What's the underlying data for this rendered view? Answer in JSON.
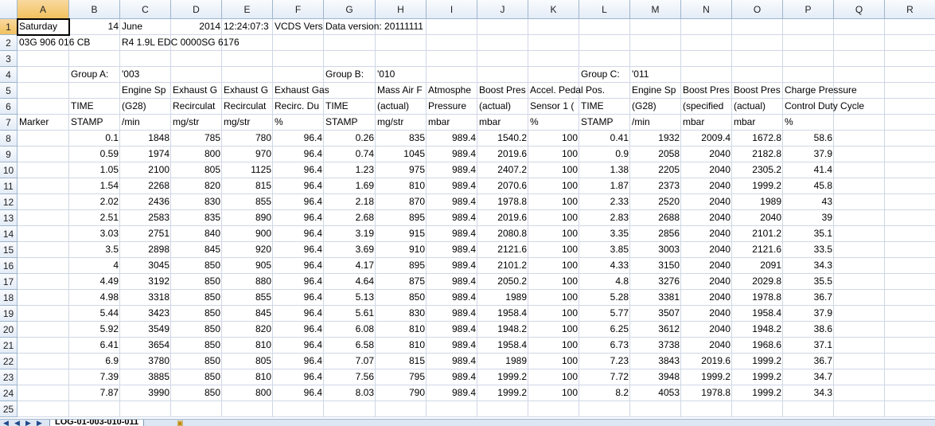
{
  "columns": [
    "A",
    "B",
    "C",
    "D",
    "E",
    "F",
    "G",
    "H",
    "I",
    "J",
    "K",
    "L",
    "M",
    "N",
    "O",
    "P",
    "Q",
    "R"
  ],
  "row_numbers": [
    "1",
    "2",
    "3",
    "4",
    "5",
    "6",
    "7",
    "8",
    "9",
    "10",
    "11",
    "12",
    "13",
    "14",
    "15",
    "16",
    "17",
    "18",
    "19",
    "20",
    "21",
    "22",
    "23",
    "24",
    "25"
  ],
  "active_cell": "A1",
  "sheet_tab": "LOG-01-003-010-011",
  "cells": [
    {
      "r": 0,
      "c": 0,
      "v": "Saturday"
    },
    {
      "r": 0,
      "c": 1,
      "v": "14",
      "n": true
    },
    {
      "r": 0,
      "c": 2,
      "v": "June"
    },
    {
      "r": 0,
      "c": 3,
      "v": "2014",
      "n": true
    },
    {
      "r": 0,
      "c": 4,
      "v": "12:24:07:3"
    },
    {
      "r": 0,
      "c": 5,
      "v": "VCDS Vers"
    },
    {
      "r": 0,
      "c": 6,
      "v": "Data version: 20111111",
      "o": true
    },
    {
      "r": 1,
      "c": 0,
      "v": "03G 906 016 CB",
      "o": true
    },
    {
      "r": 1,
      "c": 2,
      "v": "R4 1.9L EDC 0000SG  6176",
      "o": true
    },
    {
      "r": 3,
      "c": 1,
      "v": "Group A:"
    },
    {
      "r": 3,
      "c": 2,
      "v": "'003"
    },
    {
      "r": 3,
      "c": 6,
      "v": "Group B:"
    },
    {
      "r": 3,
      "c": 7,
      "v": "'010"
    },
    {
      "r": 3,
      "c": 11,
      "v": "Group C:"
    },
    {
      "r": 3,
      "c": 12,
      "v": "'011"
    },
    {
      "r": 4,
      "c": 2,
      "v": "Engine Sp"
    },
    {
      "r": 4,
      "c": 3,
      "v": "Exhaust G"
    },
    {
      "r": 4,
      "c": 4,
      "v": "Exhaust G"
    },
    {
      "r": 4,
      "c": 5,
      "v": "Exhaust Gas",
      "o": true
    },
    {
      "r": 4,
      "c": 7,
      "v": "Mass Air F"
    },
    {
      "r": 4,
      "c": 8,
      "v": "Atmosphe"
    },
    {
      "r": 4,
      "c": 9,
      "v": "Boost Pres"
    },
    {
      "r": 4,
      "c": 10,
      "v": "Accel. Pedal Pos.",
      "o": true
    },
    {
      "r": 4,
      "c": 12,
      "v": "Engine Sp"
    },
    {
      "r": 4,
      "c": 13,
      "v": "Boost Pres"
    },
    {
      "r": 4,
      "c": 14,
      "v": "Boost Pres"
    },
    {
      "r": 4,
      "c": 15,
      "v": "Charge Pressure",
      "o": true
    },
    {
      "r": 5,
      "c": 1,
      "v": "TIME"
    },
    {
      "r": 5,
      "c": 2,
      "v": "(G28)"
    },
    {
      "r": 5,
      "c": 3,
      "v": "Recirculat"
    },
    {
      "r": 5,
      "c": 4,
      "v": "Recirculat"
    },
    {
      "r": 5,
      "c": 5,
      "v": "Recirc. Du"
    },
    {
      "r": 5,
      "c": 6,
      "v": "TIME"
    },
    {
      "r": 5,
      "c": 7,
      "v": "(actual)"
    },
    {
      "r": 5,
      "c": 8,
      "v": "Pressure"
    },
    {
      "r": 5,
      "c": 9,
      "v": "(actual)"
    },
    {
      "r": 5,
      "c": 10,
      "v": "Sensor 1 ("
    },
    {
      "r": 5,
      "c": 11,
      "v": "TIME"
    },
    {
      "r": 5,
      "c": 12,
      "v": "(G28)"
    },
    {
      "r": 5,
      "c": 13,
      "v": "(specified"
    },
    {
      "r": 5,
      "c": 14,
      "v": "(actual)"
    },
    {
      "r": 5,
      "c": 15,
      "v": "Control Duty Cycle",
      "o": true
    },
    {
      "r": 6,
      "c": 0,
      "v": "Marker"
    },
    {
      "r": 6,
      "c": 1,
      "v": "STAMP"
    },
    {
      "r": 6,
      "c": 2,
      "v": "/min"
    },
    {
      "r": 6,
      "c": 3,
      "v": "mg/str"
    },
    {
      "r": 6,
      "c": 4,
      "v": "mg/str"
    },
    {
      "r": 6,
      "c": 5,
      "v": "%"
    },
    {
      "r": 6,
      "c": 6,
      "v": "STAMP"
    },
    {
      "r": 6,
      "c": 7,
      "v": "mg/str"
    },
    {
      "r": 6,
      "c": 8,
      "v": "mbar"
    },
    {
      "r": 6,
      "c": 9,
      "v": "mbar"
    },
    {
      "r": 6,
      "c": 10,
      "v": "%"
    },
    {
      "r": 6,
      "c": 11,
      "v": "STAMP"
    },
    {
      "r": 6,
      "c": 12,
      "v": "/min"
    },
    {
      "r": 6,
      "c": 13,
      "v": "mbar"
    },
    {
      "r": 6,
      "c": 14,
      "v": "mbar"
    },
    {
      "r": 6,
      "c": 15,
      "v": "%"
    }
  ],
  "data_rows": [
    [
      "0.1",
      "1848",
      "785",
      "780",
      "96.4",
      "0.26",
      "835",
      "989.4",
      "1540.2",
      "100",
      "0.41",
      "1932",
      "2009.4",
      "1672.8",
      "58.6"
    ],
    [
      "0.59",
      "1974",
      "800",
      "970",
      "96.4",
      "0.74",
      "1045",
      "989.4",
      "2019.6",
      "100",
      "0.9",
      "2058",
      "2040",
      "2182.8",
      "37.9"
    ],
    [
      "1.05",
      "2100",
      "805",
      "1125",
      "96.4",
      "1.23",
      "975",
      "989.4",
      "2407.2",
      "100",
      "1.38",
      "2205",
      "2040",
      "2305.2",
      "41.4"
    ],
    [
      "1.54",
      "2268",
      "820",
      "815",
      "96.4",
      "1.69",
      "810",
      "989.4",
      "2070.6",
      "100",
      "1.87",
      "2373",
      "2040",
      "1999.2",
      "45.8"
    ],
    [
      "2.02",
      "2436",
      "830",
      "855",
      "96.4",
      "2.18",
      "870",
      "989.4",
      "1978.8",
      "100",
      "2.33",
      "2520",
      "2040",
      "1989",
      "43"
    ],
    [
      "2.51",
      "2583",
      "835",
      "890",
      "96.4",
      "2.68",
      "895",
      "989.4",
      "2019.6",
      "100",
      "2.83",
      "2688",
      "2040",
      "2040",
      "39"
    ],
    [
      "3.03",
      "2751",
      "840",
      "900",
      "96.4",
      "3.19",
      "915",
      "989.4",
      "2080.8",
      "100",
      "3.35",
      "2856",
      "2040",
      "2101.2",
      "35.1"
    ],
    [
      "3.5",
      "2898",
      "845",
      "920",
      "96.4",
      "3.69",
      "910",
      "989.4",
      "2121.6",
      "100",
      "3.85",
      "3003",
      "2040",
      "2121.6",
      "33.5"
    ],
    [
      "4",
      "3045",
      "850",
      "905",
      "96.4",
      "4.17",
      "895",
      "989.4",
      "2101.2",
      "100",
      "4.33",
      "3150",
      "2040",
      "2091",
      "34.3"
    ],
    [
      "4.49",
      "3192",
      "850",
      "880",
      "96.4",
      "4.64",
      "875",
      "989.4",
      "2050.2",
      "100",
      "4.8",
      "3276",
      "2040",
      "2029.8",
      "35.5"
    ],
    [
      "4.98",
      "3318",
      "850",
      "855",
      "96.4",
      "5.13",
      "850",
      "989.4",
      "1989",
      "100",
      "5.28",
      "3381",
      "2040",
      "1978.8",
      "36.7"
    ],
    [
      "5.44",
      "3423",
      "850",
      "845",
      "96.4",
      "5.61",
      "830",
      "989.4",
      "1958.4",
      "100",
      "5.77",
      "3507",
      "2040",
      "1958.4",
      "37.9"
    ],
    [
      "5.92",
      "3549",
      "850",
      "820",
      "96.4",
      "6.08",
      "810",
      "989.4",
      "1948.2",
      "100",
      "6.25",
      "3612",
      "2040",
      "1948.2",
      "38.6"
    ],
    [
      "6.41",
      "3654",
      "850",
      "810",
      "96.4",
      "6.58",
      "810",
      "989.4",
      "1958.4",
      "100",
      "6.73",
      "3738",
      "2040",
      "1968.6",
      "37.1"
    ],
    [
      "6.9",
      "3780",
      "850",
      "805",
      "96.4",
      "7.07",
      "815",
      "989.4",
      "1989",
      "100",
      "7.23",
      "3843",
      "2019.6",
      "1999.2",
      "36.7"
    ],
    [
      "7.39",
      "3885",
      "850",
      "810",
      "96.4",
      "7.56",
      "795",
      "989.4",
      "1999.2",
      "100",
      "7.72",
      "3948",
      "1999.2",
      "1999.2",
      "34.7"
    ],
    [
      "7.87",
      "3990",
      "850",
      "800",
      "96.4",
      "8.03",
      "790",
      "989.4",
      "1999.2",
      "100",
      "8.2",
      "4053",
      "1978.8",
      "1999.2",
      "34.3"
    ]
  ],
  "icons": {
    "nav_first": "first-sheet-icon",
    "nav_prev": "prev-sheet-icon",
    "nav_next": "next-sheet-icon",
    "nav_last": "last-sheet-icon",
    "new_sheet": "new-sheet-icon"
  },
  "colors": {
    "grid": "#d0d7e5",
    "header_bg": "#e4ecf7",
    "active_header": "#f1c15f"
  }
}
